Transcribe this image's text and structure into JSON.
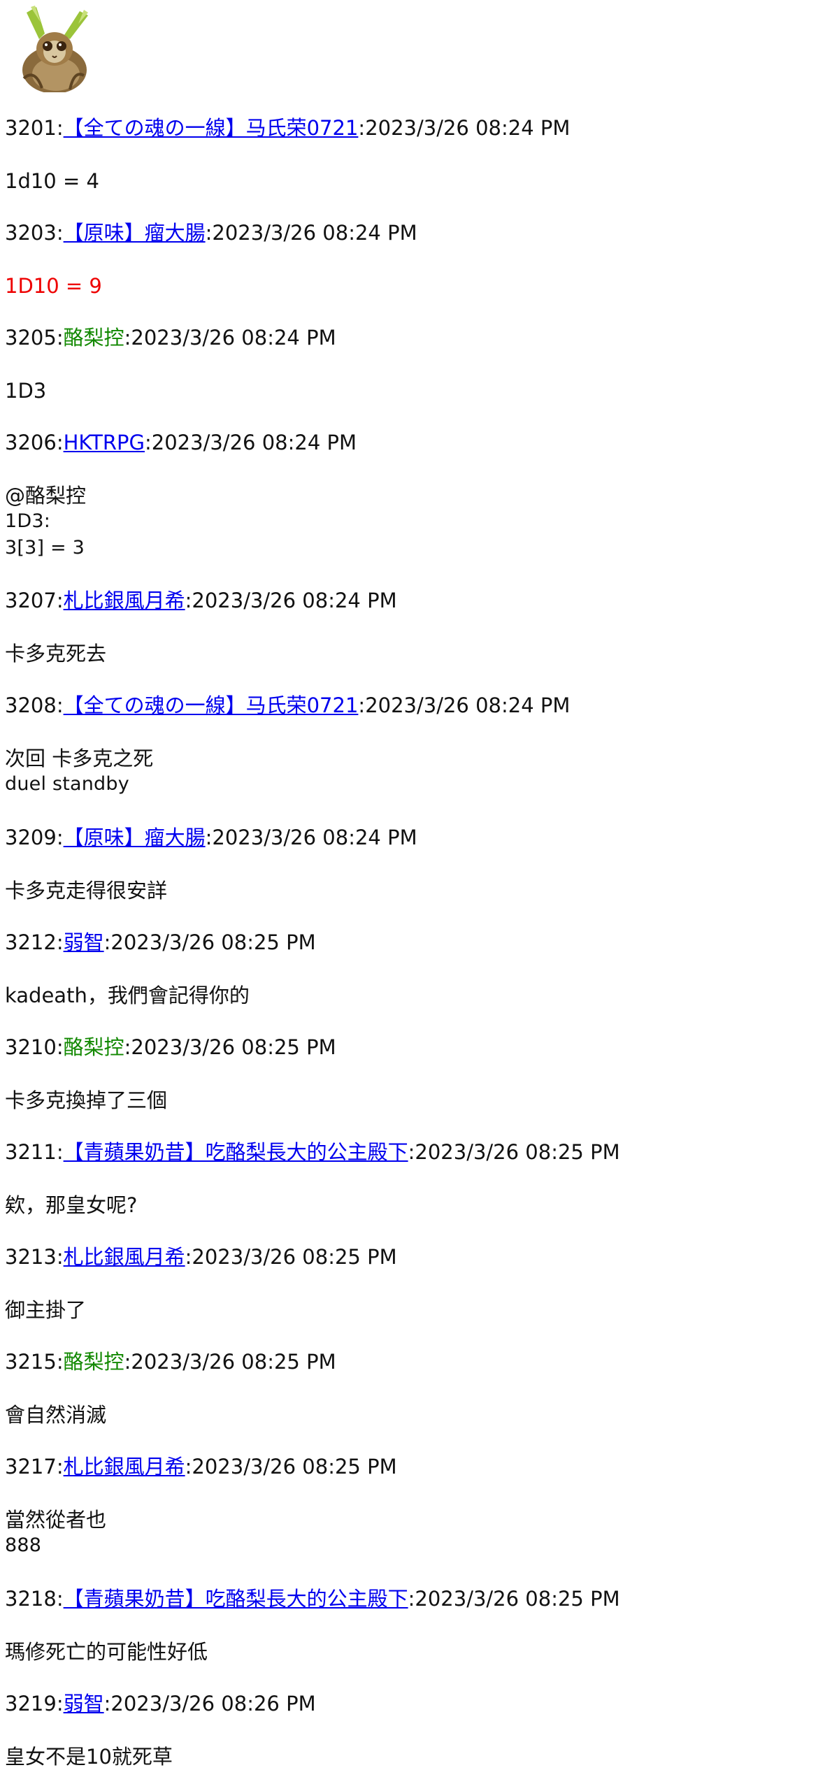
{
  "avatar": {
    "icon": "slow-loris-avatar"
  },
  "colors": {
    "link": "#0000ee",
    "green_name": "#118800",
    "red_roll": "#ee0000"
  },
  "posts": [
    {
      "num": "3201",
      "name": "【全ての魂の一線】马氏荣0721",
      "name_style": "link",
      "time": "2023/3/26 08:24 PM",
      "body": [
        "1d10 = 4"
      ]
    },
    {
      "num": "3203",
      "name": "【原味】瘤大腸",
      "name_style": "link",
      "time": "2023/3/26 08:24 PM",
      "body": [
        "1D10 = 9"
      ],
      "body_red": true
    },
    {
      "num": "3205",
      "name": "酪梨控",
      "name_style": "green",
      "time": "2023/3/26 08:24 PM",
      "body": [
        "1D3"
      ]
    },
    {
      "num": "3206",
      "name": "HKTRPG",
      "name_style": "link",
      "time": "2023/3/26 08:24 PM",
      "body": [
        "@酪梨控",
        "1D3:",
        "3[3] = 3"
      ]
    },
    {
      "num": "3207",
      "name": "札比銀風月希",
      "name_style": "link",
      "time": "2023/3/26 08:24 PM",
      "body": [
        "卡多克死去"
      ]
    },
    {
      "num": "3208",
      "name": "【全ての魂の一線】马氏荣0721",
      "name_style": "link",
      "time": "2023/3/26 08:24 PM",
      "body": [
        "次回 卡多克之死",
        "duel standby"
      ]
    },
    {
      "num": "3209",
      "name": "【原味】瘤大腸",
      "name_style": "link",
      "time": "2023/3/26 08:24 PM",
      "body": [
        "卡多克走得很安詳"
      ]
    },
    {
      "num": "3212",
      "name": "弱智",
      "name_style": "link",
      "time": "2023/3/26 08:25 PM",
      "body": [
        "kadeath，我們會記得你的"
      ]
    },
    {
      "num": "3210",
      "name": "酪梨控",
      "name_style": "green",
      "time": "2023/3/26 08:25 PM",
      "body": [
        "卡多克換掉了三個"
      ]
    },
    {
      "num": "3211",
      "name": "【青蘋果奶昔】吃酪梨長大的公主殿下",
      "name_style": "link",
      "time": "2023/3/26 08:25 PM",
      "body": [
        "欸，那皇女呢?"
      ]
    },
    {
      "num": "3213",
      "name": "札比銀風月希",
      "name_style": "link",
      "time": "2023/3/26 08:25 PM",
      "body": [
        "御主掛了"
      ]
    },
    {
      "num": "3215",
      "name": "酪梨控",
      "name_style": "green",
      "time": "2023/3/26 08:25 PM",
      "body": [
        "會自然消滅"
      ]
    },
    {
      "num": "3217",
      "name": "札比銀風月希",
      "name_style": "link",
      "time": "2023/3/26 08:25 PM",
      "body": [
        "當然從者也",
        "888"
      ]
    },
    {
      "num": "3218",
      "name": "【青蘋果奶昔】吃酪梨長大的公主殿下",
      "name_style": "link",
      "time": "2023/3/26 08:25 PM",
      "body": [
        "瑪修死亡的可能性好低"
      ]
    },
    {
      "num": "3219",
      "name": "弱智",
      "name_style": "link",
      "time": "2023/3/26 08:26 PM",
      "body": [
        "皇女不是10就死草"
      ]
    }
  ]
}
